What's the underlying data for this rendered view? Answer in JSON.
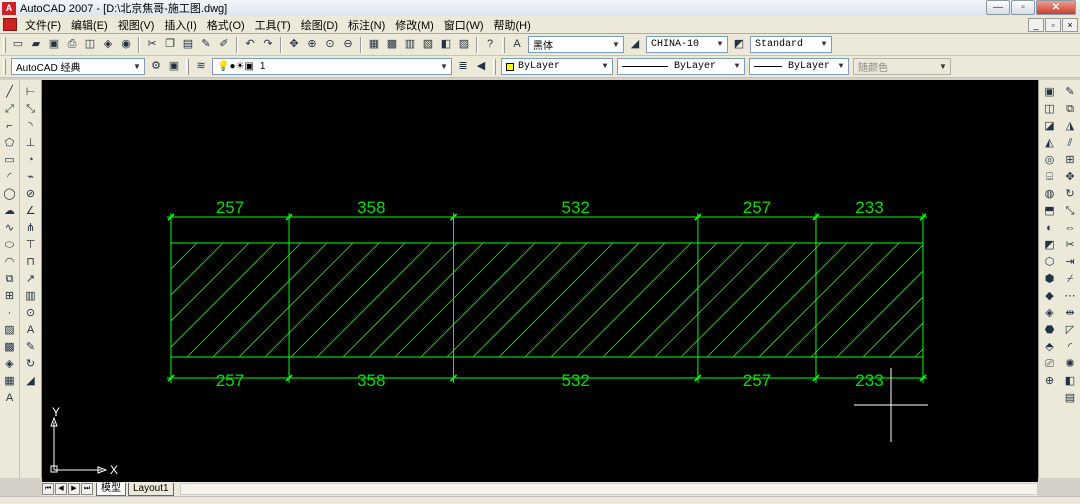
{
  "window": {
    "title": "AutoCAD 2007 - [D:\\北京焦哥-施工图.dwg]",
    "minimize": "—",
    "restore": "▫",
    "close": "✕"
  },
  "menu": {
    "items": [
      "文件(F)",
      "编辑(E)",
      "视图(V)",
      "插入(I)",
      "格式(O)",
      "工具(T)",
      "绘图(D)",
      "标注(N)",
      "修改(M)",
      "窗口(W)",
      "帮助(H)"
    ],
    "doc_min": "_",
    "doc_restore": "▫",
    "doc_close": "×"
  },
  "toolbar1": {
    "text_style": "黑体",
    "dim_style": "CHINA-10",
    "table_style": "Standard"
  },
  "toolbar2": {
    "workspace": "AutoCAD 经典",
    "layer": "1",
    "color": "ByLayer",
    "linetype": "ByLayer",
    "lineweight": "ByLayer",
    "plot_style": "随颜色"
  },
  "tabs": {
    "model": "模型",
    "layout1": "Layout1"
  },
  "ucs": {
    "x": "X",
    "y": "Y"
  },
  "drawing": {
    "segments": [
      257,
      358,
      532,
      257,
      233
    ],
    "top_labels": [
      "257",
      "358",
      "532",
      "257",
      "233"
    ],
    "bottom_labels": [
      "257",
      "358",
      "532",
      "257",
      "233"
    ],
    "line_color": "#00ff00",
    "text_color": "#00dd00"
  },
  "colors": {
    "canvas": "#000000",
    "chrome": "#ece9d8"
  }
}
